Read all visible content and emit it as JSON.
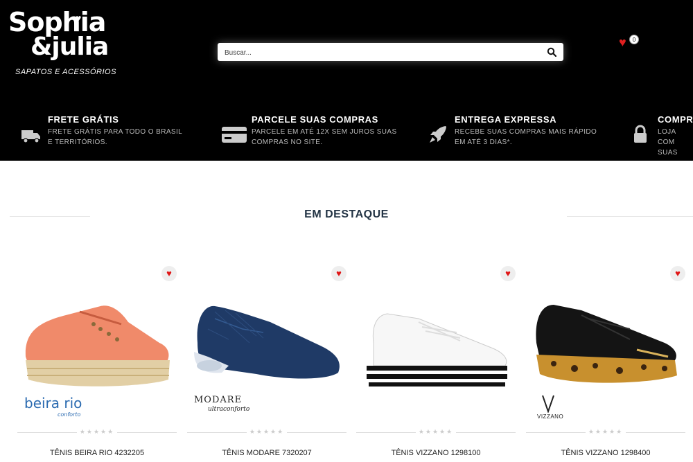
{
  "header": {
    "logo_line1": "Sophia",
    "logo_line2": "&julia",
    "logo_tagline": "SAPATOS E ACESSÓRIOS",
    "search_placeholder": "Buscar...",
    "wishlist_count": "0"
  },
  "features": [
    {
      "icon": "truck-icon",
      "title": "FRETE GRÁTIS",
      "desc": "FRETE GRÁTIS PARA TODO O BRASIL E TERRITÓRIOS."
    },
    {
      "icon": "credit-card-icon",
      "title": "PARCELE SUAS COMPRAS",
      "desc": "PARCELE EM ATÉ 12X SEM JUROS SUAS COMPRAS NO SITE."
    },
    {
      "icon": "rocket-icon",
      "title": "ENTREGA EXPRESSA",
      "desc": "RECEBE SUAS COMPRAS MAIS RÁPIDO EM ATÉ 3 DIAS*."
    },
    {
      "icon": "lock-icon",
      "title": "COMPR",
      "desc": "LOJA COM SUAS INFO"
    }
  ],
  "section": {
    "title": "EM DESTAQUE"
  },
  "products": [
    {
      "name": "TÊNIS BEIRA RIO 4232205",
      "brand": "beira rio",
      "brand_sub": "conforto",
      "stars": "★★★★★",
      "color": "#f08a6a"
    },
    {
      "name": "TÊNIS MODARE 7320207",
      "brand": "MODARE",
      "brand_sub": "ultraconforto",
      "stars": "★★★★★",
      "color": "#1f3a66"
    },
    {
      "name": "TÊNIS VIZZANO 1298100",
      "brand": "",
      "brand_sub": "",
      "stars": "★★★★★",
      "color": "#f4f4f4"
    },
    {
      "name": "TÊNIS VIZZANO 1298400",
      "brand": "VIZZANO",
      "brand_sub": "",
      "stars": "★★★★★",
      "color": "#111111"
    }
  ]
}
